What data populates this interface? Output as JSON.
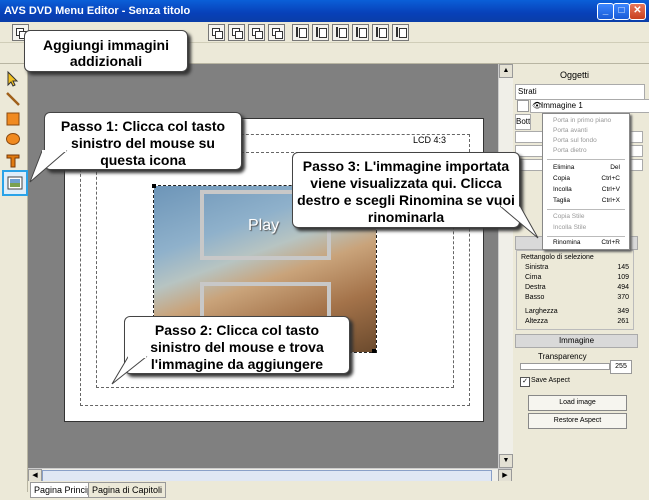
{
  "app": {
    "title": "AVS DVD Menu Editor - Senza titolo"
  },
  "window_buttons": {
    "minimize": "_",
    "maximize": "□",
    "close": "✕"
  },
  "canvas": {
    "aspect_label": "LCD 4:3",
    "menu_item_label": "Play"
  },
  "tabs": [
    "Pagina Principale",
    "Pagina di Capitoli"
  ],
  "right_panel": {
    "title": "Oggetti",
    "layers_header": "Strati",
    "selected_layer": "Immagine 1",
    "buttons_header": "Bottoni",
    "rect_section_title": "Rettangolo di selezione",
    "rect_values": [
      {
        "label": "Sinistra",
        "value": "145"
      },
      {
        "label": "Cima",
        "value": "109"
      },
      {
        "label": "Destra",
        "value": "494"
      },
      {
        "label": "Basso",
        "value": "370"
      },
      {
        "label": "Larghezza",
        "value": "349"
      },
      {
        "label": "Altezza",
        "value": "261"
      }
    ],
    "image_section_title": "Immagine",
    "transparency_label": "Transparency",
    "transparency_value": "255",
    "save_aspect_label": "Save Aspect",
    "load_image_button": "Load image",
    "restore_aspect_button": "Restore Aspect"
  },
  "context_menu": {
    "items": [
      {
        "label": "Porta in primo piano",
        "shortcut": "",
        "disabled": true
      },
      {
        "label": "Porta avanti",
        "shortcut": "",
        "disabled": true
      },
      {
        "label": "Porta sul fondo",
        "shortcut": "",
        "disabled": true
      },
      {
        "label": "Porta dietro",
        "shortcut": "",
        "disabled": true
      },
      {
        "label": "Elimina",
        "shortcut": "Del",
        "disabled": false
      },
      {
        "label": "Copia",
        "shortcut": "Ctrl+C",
        "disabled": false
      },
      {
        "label": "Incolla",
        "shortcut": "Ctrl+V",
        "disabled": false
      },
      {
        "label": "Taglia",
        "shortcut": "Ctrl+X",
        "disabled": false
      },
      {
        "label": "Copia Stile",
        "shortcut": "",
        "disabled": true
      },
      {
        "label": "Incolla Stile",
        "shortcut": "",
        "disabled": true
      },
      {
        "label": "Rinomina",
        "shortcut": "Ctrl+R",
        "disabled": false
      }
    ]
  },
  "callouts": {
    "top": "Aggiungi immagini addizionali",
    "step1": "Passo 1: Clicca col tasto sinistro del mouse su questa icona",
    "step2": "Passo 2: Clicca col tasto sinistro del mouse e trova l'immagine da aggiungere",
    "step3": "Passo 3: L'immagine importata viene visualizzata qui. Clicca destro e scegli Rinomina se vuoi rinominarla"
  },
  "icons": {
    "select_tool": "arrow-cursor-icon",
    "line_tool": "line-icon",
    "rect_tool": "rectangle-icon",
    "ellipse_tool": "ellipse-icon",
    "text_tool": "text-icon",
    "image_tool": "image-icon"
  },
  "colors": {
    "titlebar": "#0a5fd8",
    "tool_highlight": "#2aa3e8",
    "workspace": "#808080"
  }
}
